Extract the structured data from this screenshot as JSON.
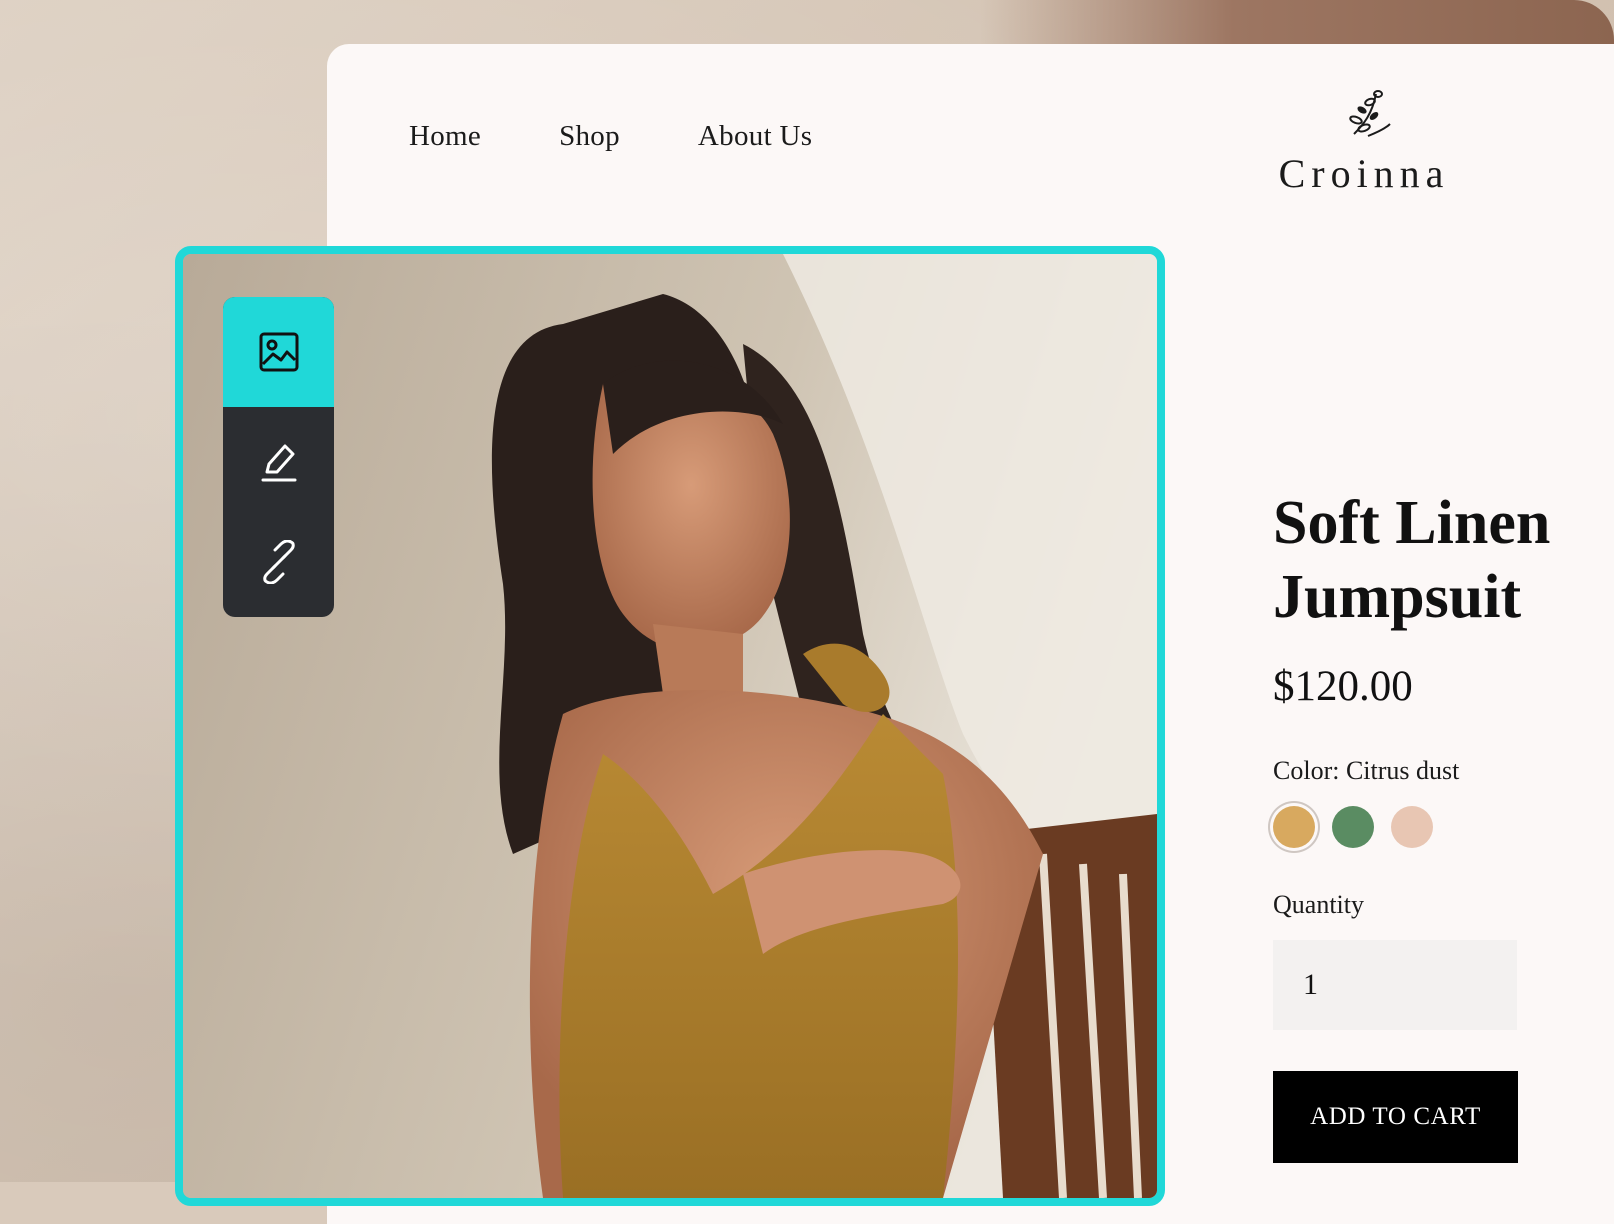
{
  "nav": {
    "links": [
      "Home",
      "Shop",
      "About Us"
    ]
  },
  "brand": {
    "name": "Croinna"
  },
  "product": {
    "title_line1": "Soft Linen",
    "title_line2": "Jumpsuit",
    "price": "$120.00",
    "color_label": "Color: Citrus dust",
    "swatches": [
      {
        "color": "#d8a95f",
        "selected": true
      },
      {
        "color": "#5a8c62",
        "selected": false
      },
      {
        "color": "#e8c6b3",
        "selected": false
      }
    ],
    "quantity_label": "Quantity",
    "quantity_value": "1",
    "cta_label": "ADD TO CART"
  },
  "editor_toolbar": {
    "tools": [
      {
        "icon": "image-icon",
        "active": true
      },
      {
        "icon": "pencil-icon",
        "active": false
      },
      {
        "icon": "link-icon",
        "active": false
      }
    ]
  },
  "colors": {
    "accent": "#20d8d8",
    "toolbar_bg": "#2b2d31",
    "page_bg": "#fcf8f7",
    "cta_bg": "#000000"
  }
}
